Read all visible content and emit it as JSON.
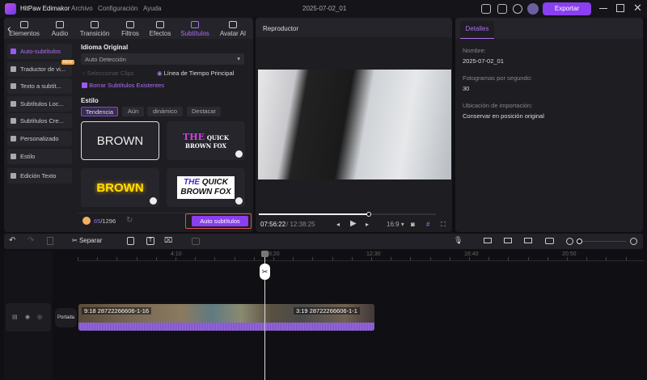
{
  "app": {
    "title": "HitPaw Edimakor",
    "menu": [
      "Archivo",
      "Configuración",
      "Ayuda"
    ],
    "project_title": "2025-07-02_01",
    "export_label": "Exportar"
  },
  "toolbar": {
    "tabs": [
      {
        "label": "Elementos",
        "icon": "elements-icon"
      },
      {
        "label": "Audio",
        "icon": "music-note-icon"
      },
      {
        "label": "Transición",
        "icon": "transition-icon"
      },
      {
        "label": "Filtros",
        "icon": "filter-icon"
      },
      {
        "label": "Efectos",
        "icon": "effects-icon"
      },
      {
        "label": "Subtítulos",
        "icon": "subtitles-icon",
        "active": true
      },
      {
        "label": "Avatar AI",
        "icon": "avatar-icon"
      }
    ]
  },
  "sidebar": {
    "items": [
      {
        "label": "Auto-subtítulos",
        "active": true
      },
      {
        "label": "Traductor de vi...",
        "badge": "NEW"
      },
      {
        "label": "Texto a subtít..."
      },
      {
        "label": "Subtítulos Loc..."
      },
      {
        "label": "Subtítulos Cre..."
      },
      {
        "label": "Personalizado"
      },
      {
        "label": "Estilo"
      },
      {
        "label": "Edición Texto"
      }
    ]
  },
  "subtitles": {
    "language_label": "Idioma Original",
    "language_value": "Auto Detección",
    "radio_clips": "Seleccionar Clips",
    "radio_timeline": "Línea de Tiempo Principal",
    "checkbox_label": "Borrar Subtítulos Existentes",
    "style_label": "Estilo",
    "style_tabs": [
      "Tendencia",
      "Aún",
      "dinámico",
      "Destacar"
    ],
    "cards": [
      {
        "line1": "BROWN"
      },
      {
        "line1": "THE",
        "line1b": "QUICK",
        "line2": "BROWN FOX"
      },
      {
        "line1": "BROWN"
      },
      {
        "line1": "THE",
        "line1b": "QUICK",
        "line2": "BROWN FOX"
      }
    ],
    "credits_used": "65",
    "credits_total": "/1296",
    "generate_button": "Auto subtítulos"
  },
  "player": {
    "title": "Reproductor",
    "current_time": "07:56:22",
    "total_time": "/ 12:38:25",
    "progress": 0.62,
    "aspect": "16:9"
  },
  "details": {
    "tab": "Detalles",
    "fields": [
      {
        "label": "Nombre:",
        "value": "2025-07-02_01"
      },
      {
        "label": "Fotogramas por segundo:",
        "value": "30"
      },
      {
        "label": "Ubicación de importación:",
        "value": "Conservar en posición original"
      }
    ]
  },
  "timeline": {
    "split_label": "Separar",
    "ruler": [
      "4:10",
      "8:20",
      "12:30",
      "16:40",
      "20:50"
    ],
    "cover_label": "Portada",
    "clips": [
      "9:18 28722266606-1-16",
      "3:19 28722266606-1-1"
    ]
  },
  "colors": {
    "accent": "#8a3ff0",
    "highlight": "#b06ef5"
  }
}
